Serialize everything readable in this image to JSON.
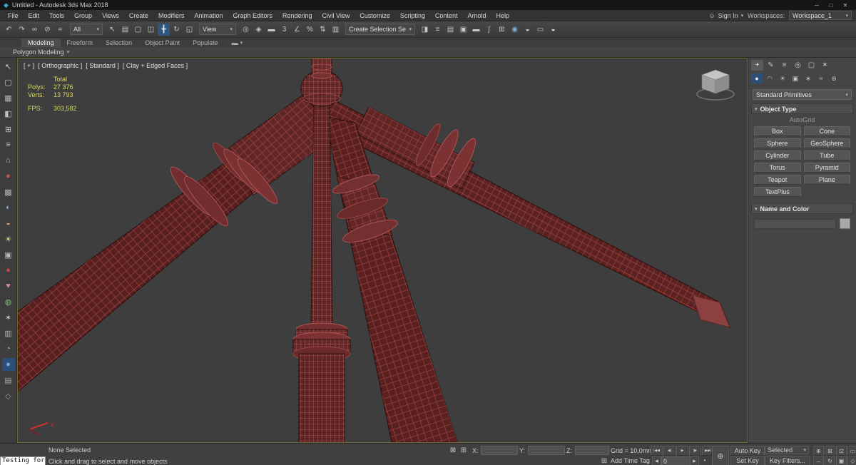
{
  "glyphs": {
    "caret": "▾"
  },
  "colors": {
    "viewport_bg": "#3e3e3e",
    "model_base": "#5c2222",
    "model_wire": "#a84c4c",
    "stats_text": "#d8d85c",
    "active_highlight": "#2e567e",
    "viewport_border": "#6b682c"
  },
  "titlebar": {
    "logo_glyph": "◆",
    "title": "Untitled - Autodesk 3ds Max 2018",
    "controls": [
      {
        "name": "minimize-button",
        "glyph": "─"
      },
      {
        "name": "maximize-button",
        "glyph": "□"
      },
      {
        "name": "close-button",
        "glyph": "✕"
      }
    ]
  },
  "menubar": {
    "items": [
      {
        "name": "menu-file",
        "label": "File"
      },
      {
        "name": "menu-edit",
        "label": "Edit"
      },
      {
        "name": "menu-tools",
        "label": "Tools"
      },
      {
        "name": "menu-group",
        "label": "Group"
      },
      {
        "name": "menu-views",
        "label": "Views"
      },
      {
        "name": "menu-create",
        "label": "Create"
      },
      {
        "name": "menu-modifiers",
        "label": "Modifiers"
      },
      {
        "name": "menu-animation",
        "label": "Animation"
      },
      {
        "name": "menu-graph-editors",
        "label": "Graph Editors"
      },
      {
        "name": "menu-rendering",
        "label": "Rendering"
      },
      {
        "name": "menu-civil-view",
        "label": "Civil View"
      },
      {
        "name": "menu-customize",
        "label": "Customize"
      },
      {
        "name": "menu-scripting",
        "label": "Scripting"
      },
      {
        "name": "menu-content",
        "label": "Content"
      },
      {
        "name": "menu-arnold",
        "label": "Arnold"
      },
      {
        "name": "menu-help",
        "label": "Help"
      }
    ],
    "signin": {
      "icon_glyph": "☺",
      "label": "Sign In"
    },
    "workspaces_label": "Workspaces:",
    "workspace_value": "Workspace_1"
  },
  "toolbar": {
    "group1": [
      {
        "name": "undo-icon",
        "glyph": "↶"
      },
      {
        "name": "redo-icon",
        "glyph": "↷"
      },
      {
        "name": "select-and-link-icon",
        "glyph": "∞"
      },
      {
        "name": "unlink-selection-icon",
        "glyph": "⊘"
      },
      {
        "name": "bind-to-space-warp-icon",
        "glyph": "≈"
      }
    ],
    "filter_value": "All",
    "group2": [
      {
        "name": "select-object-icon",
        "glyph": "↖"
      },
      {
        "name": "select-by-name-icon",
        "glyph": "▤"
      },
      {
        "name": "rectangular-selection-region-icon",
        "glyph": "▢"
      },
      {
        "name": "window-crossing-icon",
        "glyph": "◫"
      }
    ],
    "group3": [
      {
        "name": "select-and-move-icon",
        "glyph": "╋",
        "bg": "#2e567e",
        "color": "#e8f0f8"
      },
      {
        "name": "select-and-rotate-icon",
        "glyph": "↻"
      },
      {
        "name": "select-and-uniform-scale-icon",
        "glyph": "◱"
      }
    ],
    "coord_value": "View",
    "group4": [
      {
        "name": "use-pivot-point-icon",
        "glyph": "◎"
      },
      {
        "name": "select-and-manipulate-icon",
        "glyph": "◈"
      },
      {
        "name": "keyboard-shortcut-override-icon",
        "glyph": "▬"
      },
      {
        "name": "snap-toggle-3d-icon",
        "glyph": "3"
      },
      {
        "name": "angle-snap-toggle-icon",
        "glyph": "∠"
      },
      {
        "name": "percent-snap-toggle-icon",
        "glyph": "%"
      },
      {
        "name": "spinner-snap-toggle-icon",
        "glyph": "⇅"
      }
    ],
    "group5": [
      {
        "name": "edit-named-selection-sets-icon",
        "glyph": "▥"
      }
    ],
    "named_sets_value": "Create Selection Se",
    "group6": [
      {
        "name": "mirror-icon",
        "glyph": "◨"
      },
      {
        "name": "align-icon",
        "glyph": "≡"
      },
      {
        "name": "toggle-scene-explorer-icon",
        "glyph": "▤"
      },
      {
        "name": "toggle-layer-explorer-icon",
        "glyph": "▣"
      },
      {
        "name": "toggle-ribbon-icon",
        "glyph": "▬"
      },
      {
        "name": "curve-editor-icon",
        "glyph": "∫"
      },
      {
        "name": "schematic-view-icon",
        "glyph": "⊞"
      },
      {
        "name": "material-editor-icon",
        "glyph": "◉",
        "color": "#79b0dc"
      },
      {
        "name": "render-setup-icon",
        "glyph": "◒",
        "color": "#cdd8e4"
      },
      {
        "name": "rendered-frame-window-icon",
        "glyph": "▭"
      },
      {
        "name": "render-production-icon",
        "glyph": "◒",
        "color": "#e8e8e8"
      }
    ]
  },
  "ribbon": {
    "tabs": [
      {
        "name": "tab-modeling",
        "label": "Modeling",
        "active": true
      },
      {
        "name": "tab-freeform",
        "label": "Freeform"
      },
      {
        "name": "tab-selection",
        "label": "Selection"
      },
      {
        "name": "tab-object-paint",
        "label": "Object Paint"
      },
      {
        "name": "tab-populate",
        "label": "Populate"
      }
    ],
    "collapse_glyph": "▬",
    "subtab": "Polygon Modeling"
  },
  "left_toolbar": {
    "icons": [
      {
        "name": "select-cursor-icon",
        "glyph": "↖",
        "color": "#cfcfcf"
      },
      {
        "name": "selection-region-icon",
        "glyph": "▢",
        "color": "#c4c4c4"
      },
      {
        "name": "grid-snap-icon",
        "glyph": "▦",
        "color": "#b8b8b8"
      },
      {
        "name": "mirror-tool-icon",
        "glyph": "◧",
        "color": "#c0c0c0"
      },
      {
        "name": "array-tool-icon",
        "glyph": "⊞",
        "color": "#c0c0c0"
      },
      {
        "name": "align-tool-icon",
        "glyph": "≡",
        "color": "#c0c0c0"
      },
      {
        "name": "home-grid-icon",
        "glyph": "⌂",
        "color": "#c8b070"
      },
      {
        "name": "material-sphere-icon",
        "glyph": "●",
        "color": "#c25555"
      },
      {
        "name": "checker-map-icon",
        "glyph": "▩",
        "color": "#b4b4b4"
      },
      {
        "name": "blue-sphere-icon",
        "glyph": "◐",
        "color": "#8fb2da"
      },
      {
        "name": "teapot-icon",
        "glyph": "◒",
        "color": "#d4a05c"
      },
      {
        "name": "light-icon",
        "glyph": "☀",
        "color": "#ded985"
      },
      {
        "name": "camera-icon",
        "glyph": "▣",
        "color": "#b8b8b8"
      },
      {
        "name": "red-dot-icon",
        "glyph": "●",
        "color": "#cc4848"
      },
      {
        "name": "vertex-paint-icon",
        "glyph": "♥",
        "color": "#d888a0"
      },
      {
        "name": "green-sphere-icon",
        "glyph": "◍",
        "color": "#7cba7c"
      },
      {
        "name": "star-tool-icon",
        "glyph": "✶",
        "color": "#c8c8c8"
      },
      {
        "name": "panel-tool-icon",
        "glyph": "▥",
        "color": "#b0b0b0"
      },
      {
        "name": "clock-tool-icon",
        "glyph": "◔",
        "color": "#b0b0b0"
      },
      {
        "name": "active-tool-icon",
        "glyph": "●",
        "color": "#79a8e0",
        "bg": "#2d5078"
      },
      {
        "name": "layers-tool-icon",
        "glyph": "▤",
        "color": "#a8a8a8"
      },
      {
        "name": "more-tools-icon",
        "glyph": "◇",
        "color": "#9a9a9a"
      }
    ]
  },
  "viewport": {
    "label": {
      "general": "[ + ]",
      "pov": "[ Orthographic ]",
      "style": "[ Standard ]",
      "shading": "[ Clay + Edged Faces ]"
    },
    "stats": {
      "total_label": "Total",
      "polys_label": "Polys:",
      "polys_value": "27 376",
      "verts_label": "Verts:",
      "verts_value": "13 793",
      "fps_label": "FPS:",
      "fps_value": "303,582"
    },
    "axis_x": "x"
  },
  "command_panel": {
    "tabs": [
      {
        "name": "create-tab",
        "glyph": "+",
        "active": true
      },
      {
        "name": "modify-tab",
        "glyph": "✎"
      },
      {
        "name": "hierarchy-tab",
        "glyph": "≡"
      },
      {
        "name": "motion-tab",
        "glyph": "◎"
      },
      {
        "name": "display-tab",
        "glyph": "▢"
      },
      {
        "name": "utilities-tab",
        "glyph": "✶"
      }
    ],
    "categories": [
      {
        "name": "geometry-category",
        "glyph": "●",
        "active": true
      },
      {
        "name": "shapes-category",
        "glyph": "◠"
      },
      {
        "name": "lights-category",
        "glyph": "☀"
      },
      {
        "name": "cameras-category",
        "glyph": "▣"
      },
      {
        "name": "helpers-category",
        "glyph": "∗"
      },
      {
        "name": "space-warps-category",
        "glyph": "≈"
      },
      {
        "name": "systems-category",
        "glyph": "⊚"
      }
    ],
    "primitives_dropdown": "Standard Primitives",
    "object_type": "Object Type",
    "autogrid": "AutoGrid",
    "buttons": [
      {
        "name": "box-button",
        "label": "Box"
      },
      {
        "name": "cone-button",
        "label": "Cone"
      },
      {
        "name": "sphere-button",
        "label": "Sphere"
      },
      {
        "name": "geosphere-button",
        "label": "GeoSphere"
      },
      {
        "name": "cylinder-button",
        "label": "Cylinder"
      },
      {
        "name": "tube-button",
        "label": "Tube"
      },
      {
        "name": "torus-button",
        "label": "Torus"
      },
      {
        "name": "pyramid-button",
        "label": "Pyramid"
      },
      {
        "name": "teapot-button",
        "label": "Teapot"
      },
      {
        "name": "plane-button",
        "label": "Plane"
      },
      {
        "name": "textplus-button",
        "label": "TextPlus"
      }
    ],
    "name_and_color": "Name and Color"
  },
  "statusbar": {
    "listener_text": "Testing for i",
    "none_selected": "None Selected",
    "prompt": "Click and drag to select and move objects",
    "transform_icons": [
      {
        "name": "selection-lock-toggle-icon",
        "glyph": "⊠"
      },
      {
        "name": "absolute-offset-toggle-icon",
        "glyph": "⊞"
      }
    ],
    "x_label": "X:",
    "y_label": "Y:",
    "z_label": "Z:",
    "grid_label": "Grid = 10,0mm",
    "time_tag_icon": "⊞",
    "add_time_tag": "Add Time Tag",
    "playback": [
      {
        "name": "go-to-start-button",
        "glyph": "|◀◀"
      },
      {
        "name": "previous-frame-button",
        "glyph": "◀|"
      },
      {
        "name": "play-button",
        "glyph": "▶"
      },
      {
        "name": "next-frame-button",
        "glyph": "|▶"
      },
      {
        "name": "go-to-end-button",
        "glyph": "▶▶|"
      }
    ],
    "time_value": "0",
    "time_spinner_glyph": "⇅",
    "time_config_glyph": "◔",
    "set_keys_glyph": "⊕",
    "auto_key": "Auto Key",
    "selected_dropdown": "Selected",
    "set_key": "Set Key",
    "key_filters": "Key Filters...",
    "nav_row1": [
      {
        "name": "zoom-icon",
        "glyph": "⊕"
      },
      {
        "name": "zoom-all-icon",
        "glyph": "⊞"
      },
      {
        "name": "zoom-extents-icon",
        "glyph": "⊡"
      },
      {
        "name": "zoom-region-icon",
        "glyph": "▭"
      }
    ],
    "nav_row2": [
      {
        "name": "pan-view-icon",
        "glyph": "↔"
      },
      {
        "name": "orbit-icon",
        "glyph": "↻"
      },
      {
        "name": "maximize-viewport-toggle-icon",
        "glyph": "▣"
      },
      {
        "name": "walkthrough-icon",
        "glyph": "◇"
      }
    ]
  }
}
